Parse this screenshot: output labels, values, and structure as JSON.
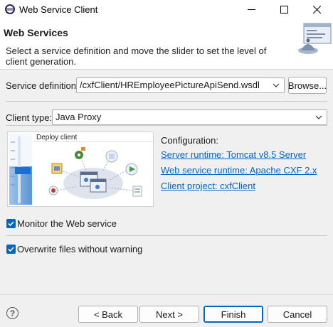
{
  "window": {
    "title": "Web Service Client"
  },
  "header": {
    "title": "Web Services",
    "description": "Select a service definition and move the slider to set the level of client generation."
  },
  "service_definition": {
    "label": "Service definition:",
    "value": "/cxfClient/HREmployeePictureApiSend.wsdl",
    "browse_label": "Browse..."
  },
  "client_type": {
    "label": "Client type:",
    "value": "Java Proxy"
  },
  "slider": {
    "stage_label": "Deploy client"
  },
  "configuration": {
    "heading": "Configuration:",
    "server_runtime": "Server runtime: Tomcat v8.5 Server",
    "ws_runtime": "Web service runtime: Apache CXF 2.x",
    "client_project": "Client project: cxfClient"
  },
  "options": {
    "monitor": {
      "label": "Monitor the Web service",
      "checked": true
    },
    "overwrite": {
      "label": "Overwrite files without warning",
      "checked": true
    }
  },
  "buttons": {
    "back": "< Back",
    "next": "Next >",
    "finish": "Finish",
    "cancel": "Cancel"
  },
  "help": "?",
  "colors": {
    "accent": "#0067c0",
    "link": "#0066cc"
  }
}
